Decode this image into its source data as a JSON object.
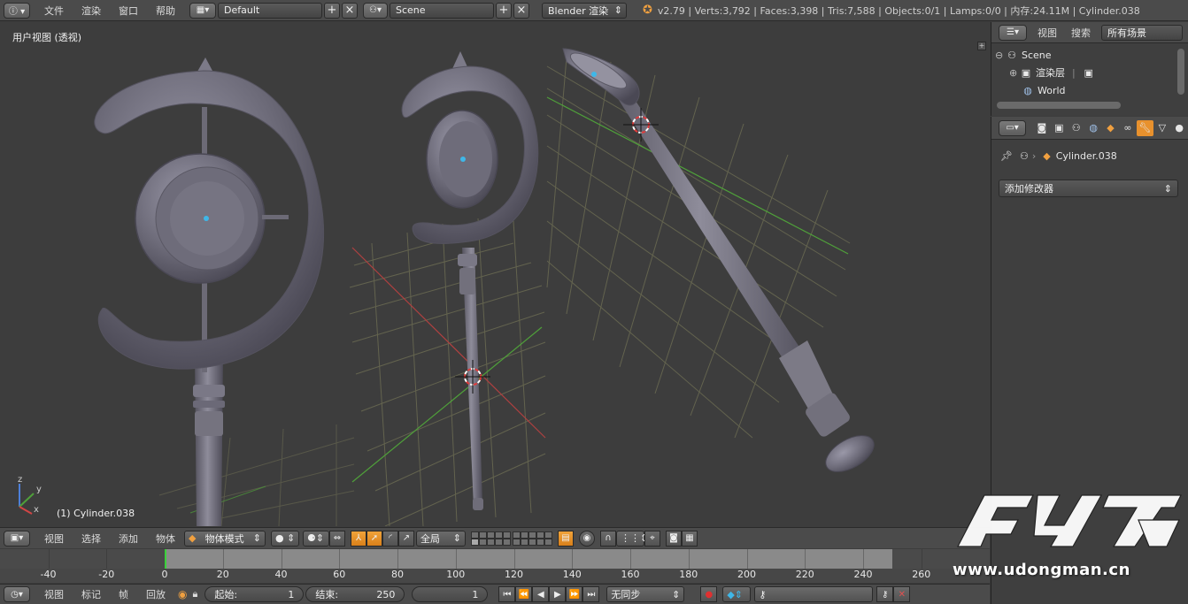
{
  "topbar": {
    "menus": [
      "文件",
      "渲染",
      "窗口",
      "帮助"
    ],
    "layout": "Default",
    "scene": "Scene",
    "engine": "Blender 渲染",
    "stats": "v2.79 | Verts:3,792 | Faces:3,398 | Tris:7,588 | Objects:0/1 | Lamps:0/0 | 内存:24.11M | Cylinder.038"
  },
  "viewport": {
    "view_label": "用户视图 (透视)",
    "object_label": "(1) Cylinder.038",
    "axis_x": "x",
    "axis_y": "y",
    "axis_z": "z"
  },
  "viewport_header": {
    "menus": [
      "视图",
      "选择",
      "添加",
      "物体"
    ],
    "mode": "物体模式",
    "pivot": "全局"
  },
  "timeline": {
    "ticks": [
      -40,
      -20,
      0,
      20,
      40,
      60,
      80,
      100,
      120,
      140,
      160,
      180,
      200,
      220,
      240,
      260
    ],
    "current_frame": 0,
    "range_start": 0,
    "range_end": 250
  },
  "timeline_header": {
    "menus": [
      "视图",
      "标记",
      "帧",
      "回放"
    ],
    "start_label": "起始:",
    "start_value": "1",
    "end_label": "结束:",
    "end_value": "250",
    "current_value": "1",
    "sync": "无同步"
  },
  "outliner": {
    "menus": [
      "视图",
      "搜索"
    ],
    "filter": "所有场景",
    "scene": "Scene",
    "render_layer": "渲染层",
    "world": "World"
  },
  "properties": {
    "object_name": "Cylinder.038",
    "add_modifier": "添加修改器"
  },
  "watermark": {
    "url": "www.udongman.cn"
  },
  "colors": {
    "accent": "#e8912d",
    "background": "#3d3d3d",
    "grid": "#6a6a52",
    "x_axis": "#b04040",
    "y_axis": "#4fa03a",
    "timeline_cursor": "#3bd13b"
  }
}
